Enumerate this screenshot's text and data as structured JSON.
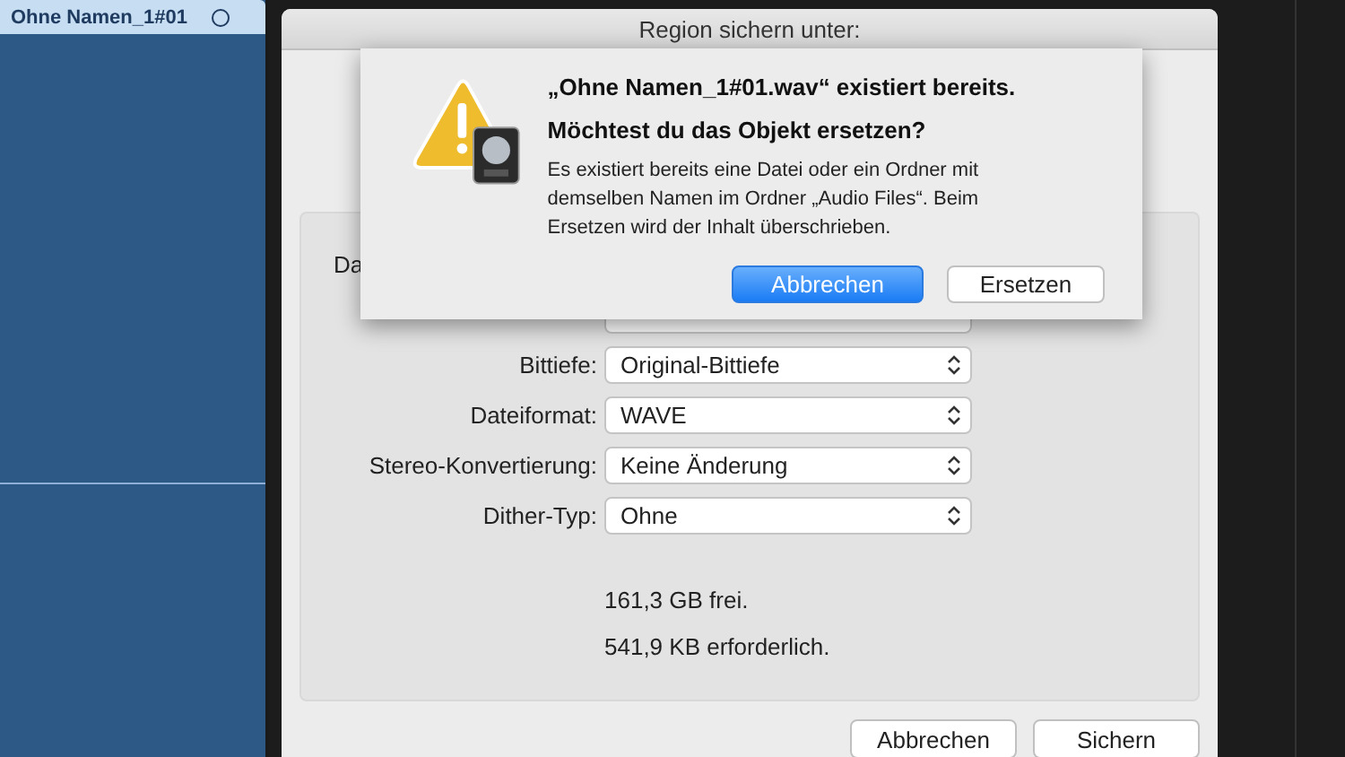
{
  "track": {
    "title": "Ohne Namen_1#01"
  },
  "sheet": {
    "title": "Region sichern unter:",
    "rows": [
      {
        "label": "Da",
        "kind": "name"
      },
      {
        "kind": "covered"
      },
      {
        "label": "Bittiefe:",
        "value": "Original-Bittiefe"
      },
      {
        "label": "Dateiformat:",
        "value": "WAVE"
      },
      {
        "label": "Stereo-Konvertierung:",
        "value": "Keine Änderung"
      },
      {
        "label": "Dither-Typ:",
        "value": "Ohne"
      }
    ],
    "free": "161,3 GB frei.",
    "required": "541,9 KB erforderlich.",
    "buttons": [
      {
        "label": "Abbrechen",
        "default": false
      },
      {
        "label": "Sichern",
        "default": false
      }
    ]
  },
  "alert": {
    "title": "„Ohne Namen_1#01.wav“ existiert bereits. Möchtest du das Objekt ersetzen?",
    "message": "Es existiert bereits eine Datei oder ein Ordner mit demselben Namen im Ordner „Audio Files“. Beim Ersetzen wird der Inhalt überschrieben.",
    "buttons": [
      {
        "label": "Abbrechen",
        "default": true
      },
      {
        "label": "Ersetzen",
        "default": false
      }
    ]
  }
}
